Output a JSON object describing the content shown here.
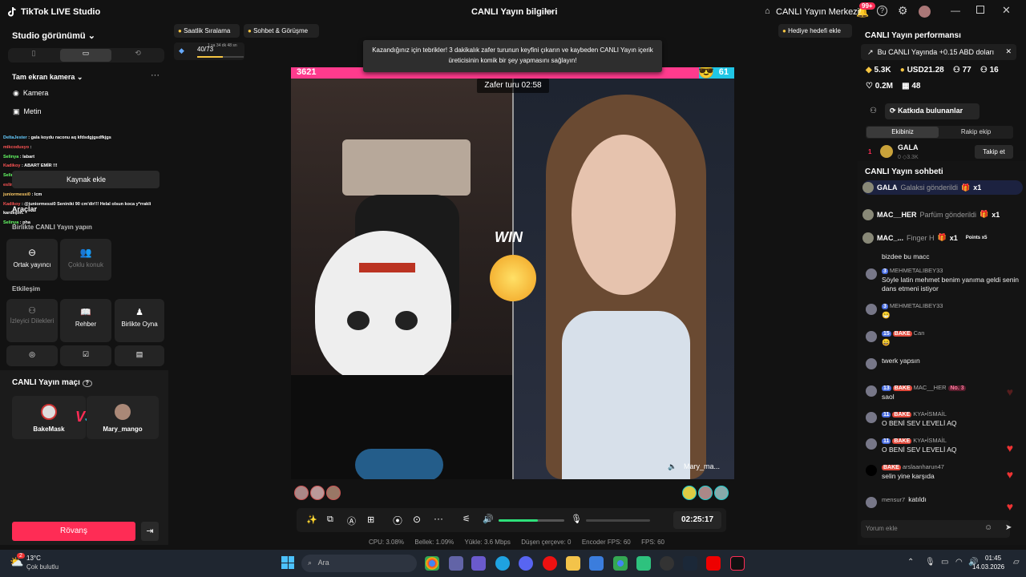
{
  "app": {
    "title": "TikTok LIVE Studio",
    "center_title": "CANLI Yayın bilgileri",
    "center_menu": "CANLI Yayın Merkezi",
    "notif_count": "99+"
  },
  "left": {
    "studio_view": "Studio görünümü",
    "scene": "Tam ekran kamera",
    "sources": [
      "Kamera",
      "Metin"
    ],
    "add_source": "Kaynak ekle",
    "tools": "Araçlar",
    "together": "Birlikte CANLI Yayın yapın",
    "cohost": "Ortak yayıncı",
    "multiguest": "Çoklu konuk",
    "interaction": "Etkileşim",
    "viewer_wishes": "İzleyici Dilekleri",
    "guide": "Rehber",
    "play_together": "Birlikte Oyna",
    "match_title": "CANLI Yayın maçı",
    "player1": "BakeMask",
    "player2": "Mary_mango",
    "rematch": "Rövanş",
    "overlay_chat": [
      {
        "user": "DeltaJester",
        "text": ": gala koydu raconu aq kfdsdgjgsdfkjgs",
        "color": "#6cf"
      },
      {
        "user": "mikcodusyo",
        "text": ":",
        "color": "#f55"
      },
      {
        "user": "Selinya",
        "text": ": labart",
        "color": "#6f6"
      },
      {
        "user": "Kadikoy",
        "text": ": ABART EMİR !!!",
        "color": "#f55"
      },
      {
        "user": "Selinya",
        "text": ": lcm",
        "color": "#6f6"
      },
      {
        "user": "eslimnam",
        "text": ": lcm",
        "color": "#f55"
      },
      {
        "user": "juniormessi0",
        "text": ": lcm",
        "color": "#fc6"
      },
      {
        "user": "Kadikoy",
        "text": ": @juniormessi0 Senin​iki 90 cm'dir!!! Helal olsun koca y*rrakli kardeşim.",
        "color": "#f55"
      },
      {
        "user": "Selinya",
        "text": ": pha",
        "color": "#6f6"
      }
    ]
  },
  "top_chips": {
    "hourly": "Saatlik Sıralama",
    "chat": "Sohbet & Görüşme",
    "gift_goal": "Hediye hedefi ekle",
    "progress": "40/73",
    "progress_time": "1 sa 34 dk 48 sn"
  },
  "banner": "Kazandığınız için tebrikler! 3 dakikalık zafer turunun keyfini çıkarın ve kaybeden CANLI Yayın içerik üreticisinin komik bir şey yapmasını sağlayın!",
  "battle": {
    "score_left": "3621",
    "score_right": "61",
    "left_fraction": 0.92,
    "victory": "Zafer turu 02:58",
    "win": "WIN",
    "right_name": "Mary_ma..."
  },
  "controls": {
    "timer": "02:25:17",
    "volume_fraction": 0.6
  },
  "stats": {
    "cpu": "CPU:  3.08%",
    "memory": "Bellek:  1.09%",
    "upload": "Yükle:  3.6 Mbps",
    "dropped": "Düşen çerçeve:  0",
    "encoder": "Encoder FPS:  60",
    "fps": "FPS:  60"
  },
  "right": {
    "perf_title": "CANLI Yayın performansı",
    "earning": "Bu CANLI Yayında +0.15 ABD doları",
    "diamonds": "5.3K",
    "usd": "USD21.28",
    "viewers": "77",
    "likes_count": "16",
    "views": "0.2M",
    "gifts": "48",
    "contributors": "Katkıda bulunanlar",
    "tab_team": "Ekibiniz",
    "tab_rival": "Rakip ekip",
    "top_rank": "1",
    "top_user": "GALA",
    "top_sub": "0 ◇3.3K",
    "follow": "Takip et",
    "chat_title": "CANLI Yayın sohbeti",
    "gifts_feed": [
      {
        "user": "GALA",
        "text": "Galaksi gönderildi",
        "mult": "x1"
      },
      {
        "user": "MAC__HER",
        "text": "Parfüm gönderildi",
        "mult": "x1"
      },
      {
        "user": "MAC_...",
        "text": "Finger H",
        "mult": "x1",
        "extra": "Points x5"
      }
    ],
    "messages": [
      {
        "user": "",
        "text": "bizdee bu macc",
        "level": "",
        "fan": ""
      },
      {
        "user": "MEHMETALIBEY33",
        "text": "Söyle latin mehmet benim yanıma geldi senin dans etmeni istiyor",
        "level": "3",
        "fan": ""
      },
      {
        "user": "MEHMETALIBEY33",
        "text": "😁",
        "level": "3",
        "fan": ""
      },
      {
        "user": "Can",
        "text": "😄",
        "level": "15",
        "fan": "BAKE"
      },
      {
        "user": "",
        "text": "twerk yapsın",
        "level": "",
        "fan": ""
      },
      {
        "user": "MAC__HER",
        "text": "saol",
        "level": "13",
        "fan": "BAKE",
        "extra": "No. 3"
      },
      {
        "user": "KYA•İSMAİL",
        "text": "O BENİ SEV LEVELİ AQ",
        "level": "11",
        "fan": "BAKE"
      },
      {
        "user": "KYA•İSMAİL",
        "text": "O BENİ SEV LEVELİ AQ",
        "level": "11",
        "fan": "BAKE"
      },
      {
        "user": "arslaanharun47",
        "text": "selin yine karşıda",
        "level": "",
        "fan": "BAKE"
      },
      {
        "user": "mensur7",
        "text": "katıldı",
        "level": "",
        "fan": ""
      }
    ],
    "comment_placeholder": "Yorum ekle"
  },
  "taskbar": {
    "temp": "13°C",
    "weather": "Çok bulutlu",
    "weather_badge": "2",
    "search": "Ara",
    "time": "01:45",
    "date": "14.03.2026"
  },
  "colors": {
    "accent": "#fe2c55",
    "score_left": "#ff3b8d",
    "score_right": "#20c6e6",
    "green": "#2ee07a"
  }
}
